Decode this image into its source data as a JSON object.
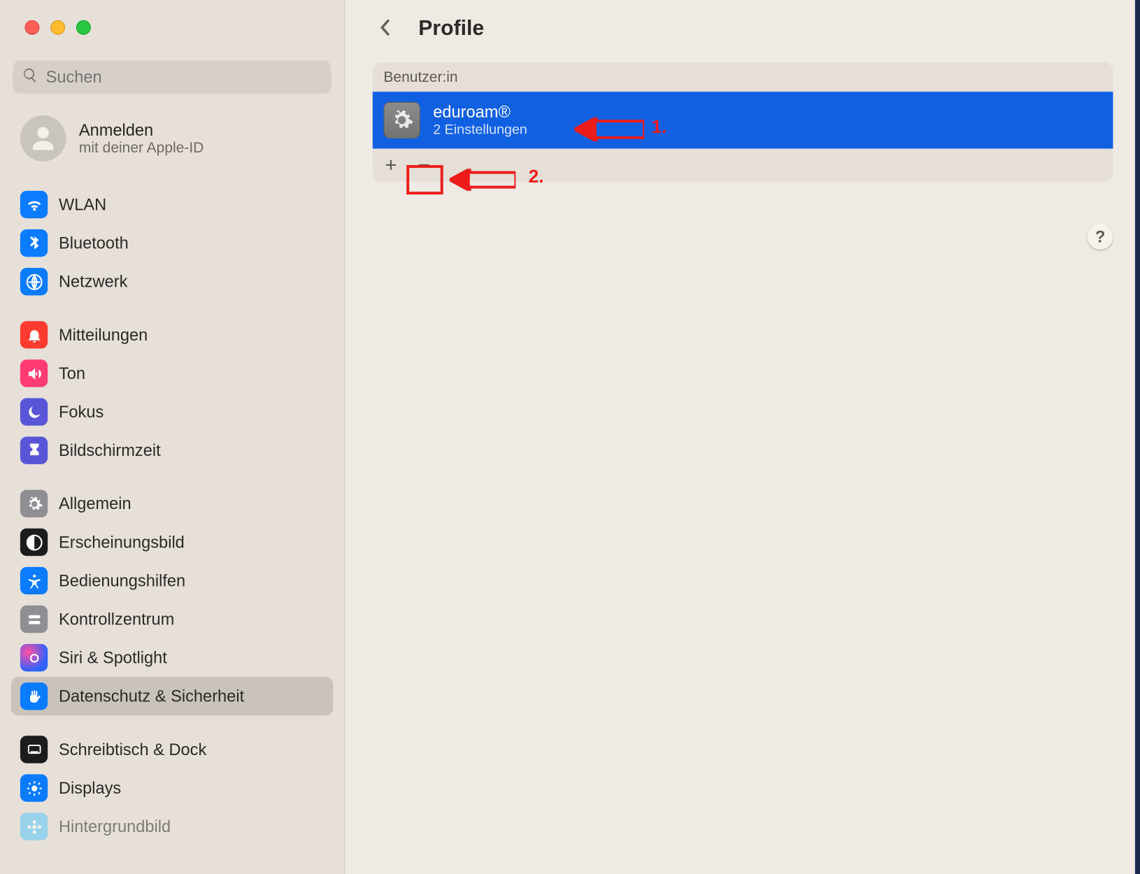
{
  "search": {
    "placeholder": "Suchen"
  },
  "account": {
    "title": "Anmelden",
    "subtitle": "mit deiner Apple-ID"
  },
  "sidebar": {
    "group1": [
      {
        "label": "WLAN"
      },
      {
        "label": "Bluetooth"
      },
      {
        "label": "Netzwerk"
      }
    ],
    "group2": [
      {
        "label": "Mitteilungen"
      },
      {
        "label": "Ton"
      },
      {
        "label": "Fokus"
      },
      {
        "label": "Bildschirmzeit"
      }
    ],
    "group3": [
      {
        "label": "Allgemein"
      },
      {
        "label": "Erscheinungsbild"
      },
      {
        "label": "Bedienungshilfen"
      },
      {
        "label": "Kontrollzentrum"
      },
      {
        "label": "Siri & Spotlight"
      },
      {
        "label": "Datenschutz & Sicherheit"
      }
    ],
    "group4": [
      {
        "label": "Schreibtisch & Dock"
      },
      {
        "label": "Displays"
      },
      {
        "label": "Hintergrundbild"
      }
    ]
  },
  "header": {
    "title": "Profile"
  },
  "panel": {
    "section_title": "Benutzer:in",
    "profile_name": "eduroam®",
    "profile_sub": "2 Einstellungen",
    "add": "+",
    "remove": "−"
  },
  "help": "?",
  "annotations": {
    "label1": "1.",
    "label2": "2."
  }
}
